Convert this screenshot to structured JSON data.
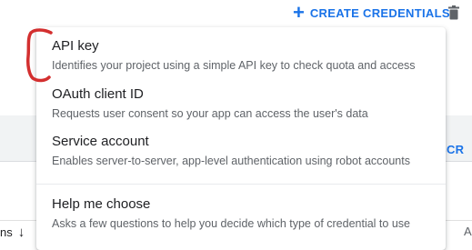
{
  "toolbar": {
    "create_label": "CREATE CREDENTIALS",
    "plus_icon": "+",
    "trash_icon": "trash-icon"
  },
  "background": {
    "right_button_fragment": "T SCR",
    "bottom_left_fragment": "ns",
    "sort_arrow": "↓",
    "bottom_right_fragment": "A"
  },
  "menu": {
    "items": [
      {
        "title": "API key",
        "desc": "Identifies your project using a simple API key to check quota and access"
      },
      {
        "title": "OAuth client ID",
        "desc": "Requests user consent so your app can access the user's data"
      },
      {
        "title": "Service account",
        "desc": "Enables server-to-server, app-level authentication using robot accounts"
      },
      {
        "title": "Help me choose",
        "desc": "Asks a few questions to help you decide which type of credential to use"
      }
    ]
  },
  "colors": {
    "accent": "#1a73e8",
    "annotation": "#d32f2f"
  }
}
